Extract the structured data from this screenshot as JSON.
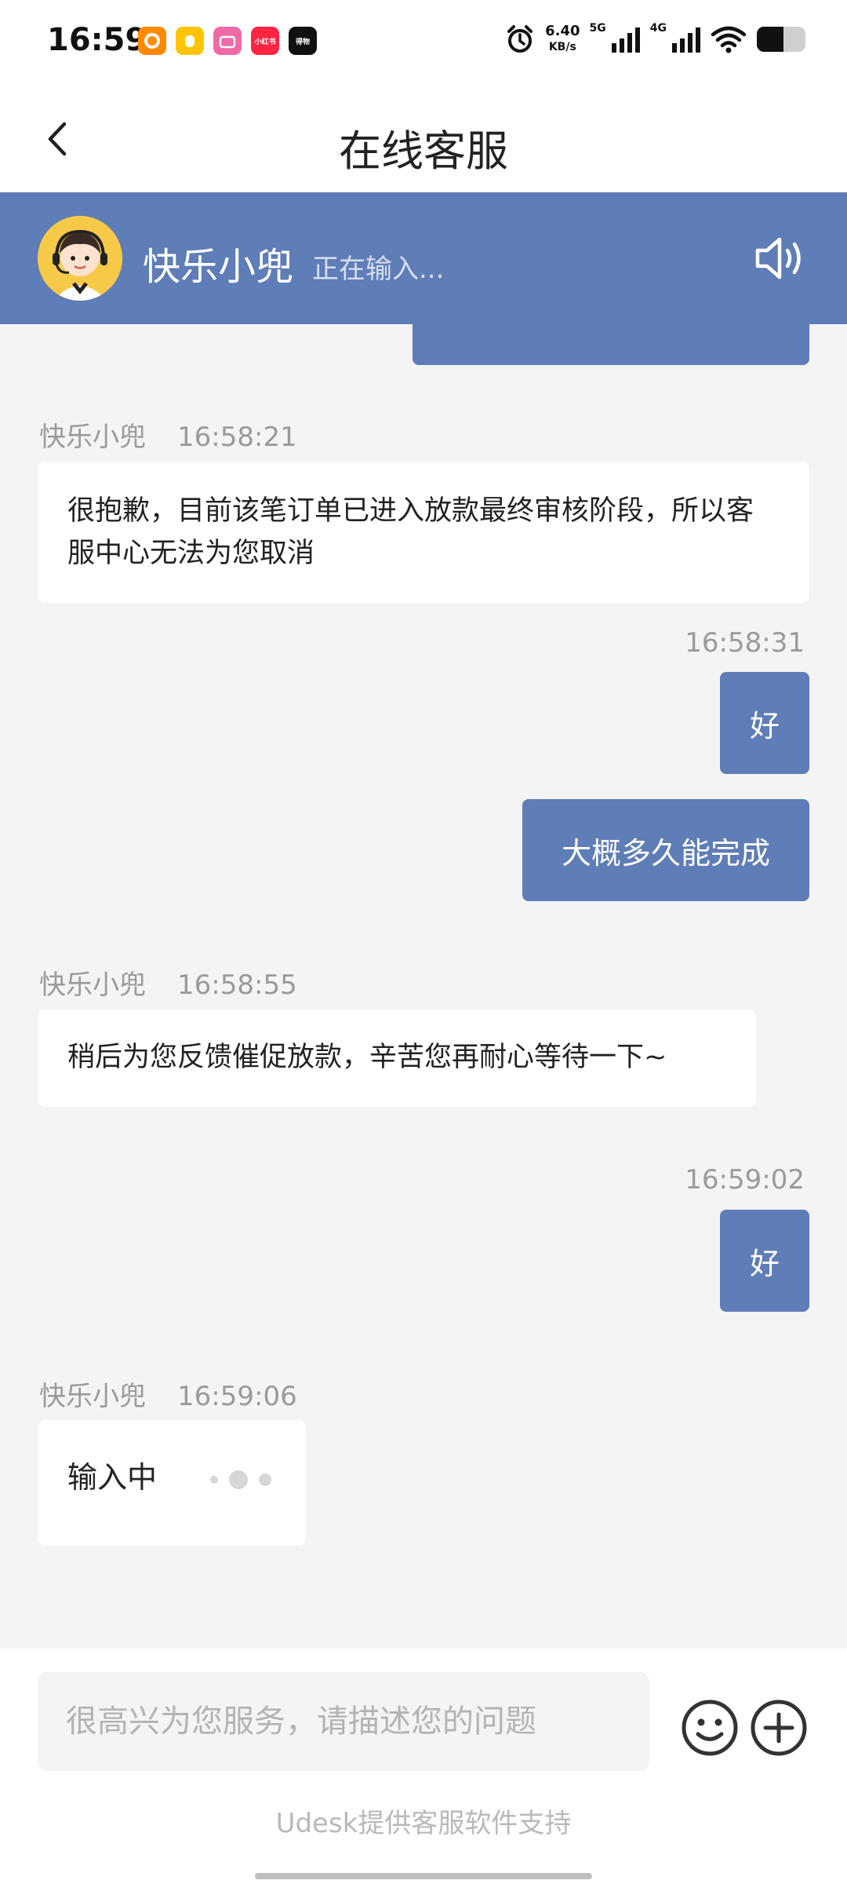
{
  "status_bar": {
    "time": "16:59",
    "net_speed": "6.40",
    "net_unit": "KB/s",
    "sim1": "5G",
    "sim2": "4G",
    "apps": [
      "taobao-icon",
      "hand-icon",
      "bilibili-icon",
      "xiaohongshu-icon",
      "dewu-icon"
    ],
    "app_labels": {
      "xiaohongshu": "小红书",
      "dewu": "得物"
    }
  },
  "header": {
    "title": "在线客服"
  },
  "agent": {
    "name": "快乐小兜",
    "status": "正在输入..."
  },
  "messages": [
    {
      "side": "left",
      "sender": "快乐小兜",
      "time": "16:58:21",
      "text": "很抱歉，目前该笔订单已进入放款最终审核阶段，所以客服中心无法为您取消"
    },
    {
      "side": "right",
      "time": "16:58:31",
      "text": "好"
    },
    {
      "side": "right",
      "text": "大概多久能完成"
    },
    {
      "side": "left",
      "sender": "快乐小兜",
      "time": "16:58:55",
      "text": "稍后为您反馈催促放款，辛苦您再耐心等待一下~"
    },
    {
      "side": "right",
      "time": "16:59:02",
      "text": "好"
    },
    {
      "side": "left",
      "sender": "快乐小兜",
      "time": "16:59:06",
      "text": "输入中"
    }
  ],
  "input": {
    "placeholder": "很高兴为您服务，请描述您的问题"
  },
  "footer": {
    "powered_by": "Udesk提供客服软件支持"
  },
  "colors": {
    "accent": "#5f7db6",
    "background": "#f4f4f4"
  }
}
